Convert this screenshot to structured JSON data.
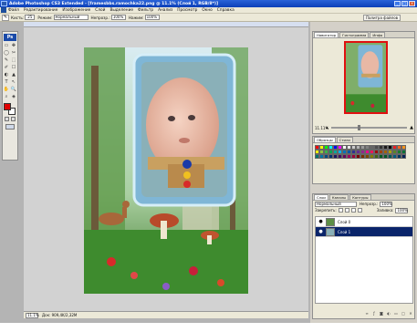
{
  "window": {
    "title": "Adobe Photoshop CS3 Extended - [framesbbs.ramochka22.png @ 11.1% (Слой 1, RGB/8*)]",
    "minimize": "_",
    "maximize": "□",
    "close": "×"
  },
  "menu": [
    "Файл",
    "Редактирование",
    "Изображение",
    "Слой",
    "Выделение",
    "Фильтр",
    "Анализ",
    "Просмотр",
    "Окно",
    "Справка"
  ],
  "options": {
    "brush_label": "Кисть:",
    "brush_size": "25",
    "mode_label": "Режим:",
    "mode_value": "Нормальный",
    "opacity_label": "Непрозр.:",
    "opacity_value": "100%",
    "flow_label": "Нажим:",
    "flow_value": "100%",
    "palettes_button": "Палитра файлов"
  },
  "toolbox": {
    "badge": "Ps",
    "tools": [
      "▭",
      "✥",
      "◯",
      "✂",
      "✎",
      "⬚",
      "✐",
      "☐",
      "◐",
      "▲",
      "T",
      "↖",
      "✋",
      "🔍",
      "⌕",
      "◈"
    ],
    "foreground_color": "#e00000",
    "background_color": "#ffffff"
  },
  "document": {
    "zoom": "11.1%",
    "info": "Док: 909,4K/2,32M"
  },
  "navigator": {
    "tabs": [
      "Навигатор",
      "Гистограмма",
      "Инфо"
    ],
    "zoom": "11.11%",
    "slider_position": 0.35
  },
  "swatches": {
    "tabs": [
      "Образцы",
      "Стили"
    ],
    "colors": [
      "#ff0000",
      "#ffff00",
      "#00ff00",
      "#00ffff",
      "#0000ff",
      "#ff00ff",
      "#ffffff",
      "#e6e6e6",
      "#cccccc",
      "#b3b3b3",
      "#999999",
      "#808080",
      "#666666",
      "#4d4d4d",
      "#333333",
      "#1a1a1a",
      "#000000",
      "#ed1c24",
      "#f26522",
      "#f7941d",
      "#fff200",
      "#8dc63f",
      "#39b54a",
      "#00a651",
      "#00a99d",
      "#00aeef",
      "#0072bc",
      "#0054a6",
      "#2e3192",
      "#662d91",
      "#92278f",
      "#ec008c",
      "#ed145b",
      "#9e0b0f",
      "#a0410d",
      "#a36209",
      "#aba000",
      "#598527",
      "#1a7b30",
      "#007236",
      "#00746b",
      "#0076a3",
      "#004b80",
      "#003471",
      "#1b1464",
      "#440e62",
      "#630460",
      "#9e005d",
      "#9e0039",
      "#790000",
      "#7b2e00",
      "#7d4900",
      "#827b00",
      "#406618",
      "#005e20",
      "#005826",
      "#005952",
      "#005b7f",
      "#003663",
      "#002157"
    ]
  },
  "layers": {
    "tabs": [
      "Слои",
      "Каналы",
      "Контуры"
    ],
    "blend_mode": "Нормальный",
    "opacity_label": "Непрозр.:",
    "opacity_value": "100%",
    "lock_label": "Закрепить:",
    "fill_label": "Заливка:",
    "fill_value": "100%",
    "items": [
      {
        "name": "Слой 0",
        "selected": false
      },
      {
        "name": "Слой 1",
        "selected": true
      }
    ]
  }
}
